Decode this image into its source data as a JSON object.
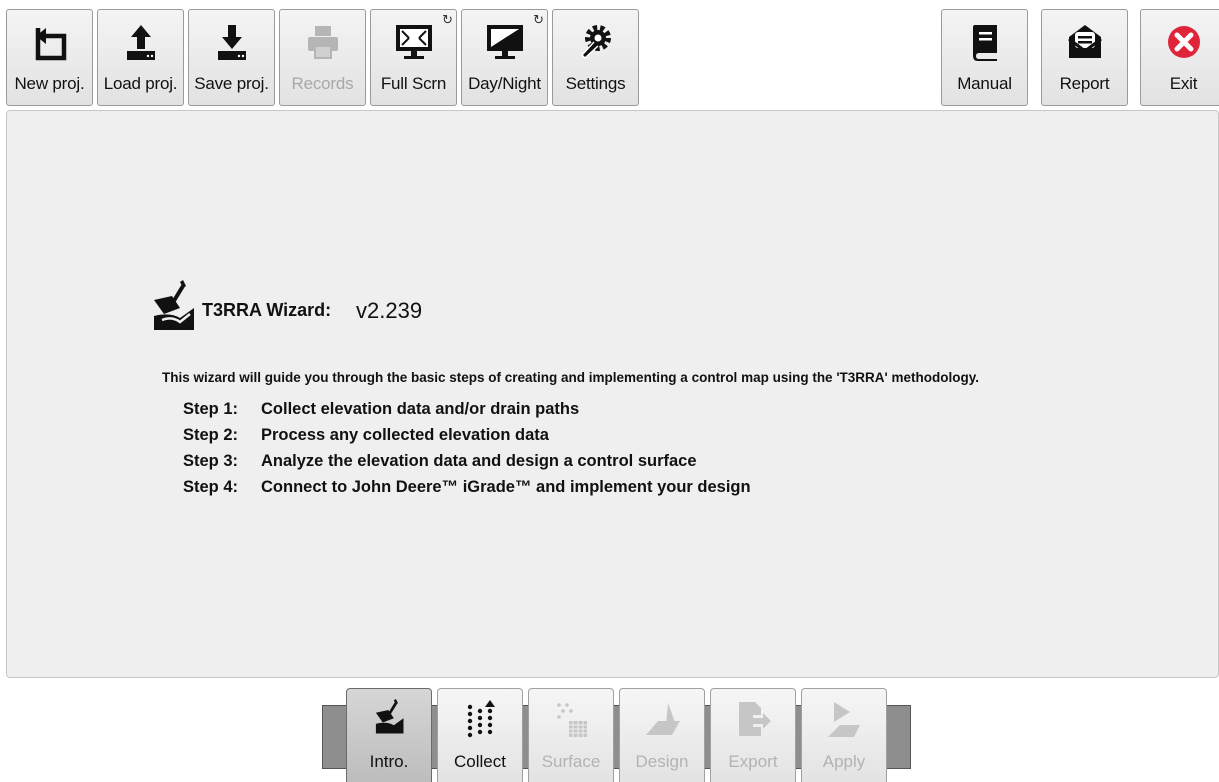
{
  "toolbar": {
    "new_proj": "New proj.",
    "load_proj": "Load proj.",
    "save_proj": "Save proj.",
    "records": "Records",
    "full_scrn": "Full Scrn",
    "day_night": "Day/Night",
    "settings": "Settings",
    "manual": "Manual",
    "report": "Report",
    "exit": "Exit"
  },
  "wizard": {
    "title": "T3RRA Wizard:",
    "version": "v2.239",
    "intro": "This wizard will guide you through the basic steps of creating and implementing a control map using the 'T3RRA' methodology.",
    "steps": [
      {
        "label": "Step 1:",
        "text": "Collect elevation data and/or drain paths"
      },
      {
        "label": "Step 2:",
        "text": "Process any collected elevation data"
      },
      {
        "label": "Step 3:",
        "text": "Analyze the elevation data and design a control surface"
      },
      {
        "label": "Step 4:",
        "text": "Connect to John Deere™ iGrade™ and implement your design"
      }
    ]
  },
  "tabs": {
    "intro": "Intro.",
    "collect": "Collect",
    "surface": "Surface",
    "design": "Design",
    "export": "Export",
    "apply": "Apply"
  },
  "icons": {
    "new_proj": "undo-arrow-icon",
    "load_proj": "upload-icon",
    "save_proj": "download-icon",
    "records": "printer-icon",
    "full_scrn": "fullscreen-monitor-icon",
    "day_night": "day-night-monitor-icon",
    "settings": "gear-wrench-icon",
    "manual": "book-icon",
    "report": "envelope-report-icon",
    "exit": "close-circle-icon"
  },
  "colors": {
    "exit_icon": "#e0243a",
    "disabled_text": "#a8a8a8",
    "panel_bg": "#efefef",
    "tab_bar": "#8e8e8e"
  }
}
